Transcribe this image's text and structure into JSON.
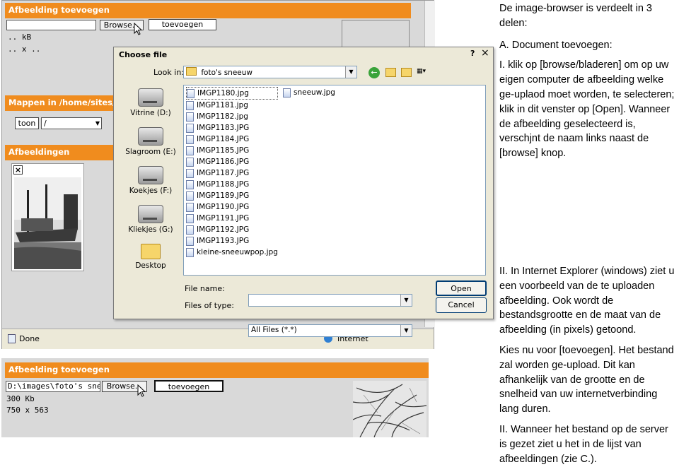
{
  "top_panel": {
    "header": "Afbeelding toevoegen",
    "browse_label": "Browse...",
    "toevoegen_label": "toevoegen",
    "line_kb": ".. kB",
    "line_xx": ".. x ..",
    "folders_header": "Mappen in /home/sites/",
    "toon_label": "toon",
    "folder_path": "/",
    "images_header": "Afbeeldingen",
    "delete_label": "×",
    "status_done": "Done",
    "status_zone": "Internet"
  },
  "dialog": {
    "title": "Choose file",
    "help_label": "?",
    "close_label": "×",
    "look_in_label": "Look in:",
    "look_in_value": "foto's sneeuw",
    "places": [
      {
        "label": "Vitrine (D:)",
        "icon": "drive-icon"
      },
      {
        "label": "Slagroom (E:)",
        "icon": "drive-icon"
      },
      {
        "label": "Koekjes (F:)",
        "icon": "drive-icon"
      },
      {
        "label": "Kliekjes (G:)",
        "icon": "drive-icon"
      },
      {
        "label": "Desktop",
        "icon": "folder-icon"
      }
    ],
    "files_col1": [
      "IMGP1180.jpg",
      "IMGP1181.jpg",
      "IMGP1182.jpg",
      "IMGP1183.JPG",
      "IMGP1184.JPG",
      "IMGP1185.JPG",
      "IMGP1186.JPG",
      "IMGP1187.JPG",
      "IMGP1188.JPG",
      "IMGP1189.JPG",
      "IMGP1190.JPG",
      "IMGP1191.JPG",
      "IMGP1192.JPG",
      "IMGP1193.JPG",
      "kleine-sneeuwpop.jpg"
    ],
    "files_col2": [
      "sneeuw.jpg"
    ],
    "file_name_label": "File name:",
    "file_name_value": "",
    "file_type_label": "Files of type:",
    "file_type_value": "All Files (*.*)",
    "open_label": "Open",
    "cancel_label": "Cancel"
  },
  "bottom_panel": {
    "header": "Afbeelding toevoegen",
    "path_value": "D:\\images\\foto's sneeu",
    "browse_label": "Browse...",
    "toevoegen_label": "toevoegen",
    "size": "300 Kb",
    "dimensions": "750 x 563"
  },
  "instructions": {
    "p1": "De image-browser is verdeelt in 3 delen:",
    "p2": "A. Document toevoegen:",
    "p3": "I. klik op [browse/bladeren] om op uw eigen computer de afbeelding welke ge-uplaod moet worden, te selecteren; klik in dit venster op [Open]. Wanneer de afbeelding geselecteerd is, verschjnt de naam links naast de [browse] knop.",
    "p4": "II. In Internet Explorer (windows) ziet u een voorbeeld van de te uploaden afbeelding. Ook wordt de bestandsgrootte en de maat van de afbeelding (in pixels) getoond.",
    "p5": "Kies nu voor [toevoegen]. Het bestand zal worden ge-upload. Dit kan afhankelijk van de grootte en de snelheid van uw internetverbinding lang duren.",
    "p6": "II. Wanneer het bestand op de server is gezet ziet u het in de lijst van afbeeldingen (zie C.)."
  }
}
